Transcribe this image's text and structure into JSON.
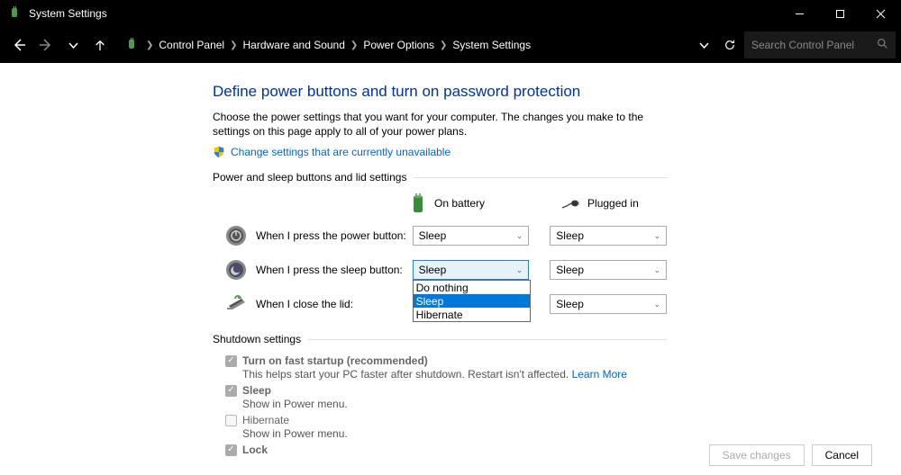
{
  "window": {
    "title": "System Settings"
  },
  "breadcrumb": {
    "items": [
      "Control Panel",
      "Hardware and Sound",
      "Power Options",
      "System Settings"
    ]
  },
  "search": {
    "placeholder": "Search Control Panel"
  },
  "page": {
    "title": "Define power buttons and turn on password protection",
    "description": "Choose the power settings that you want for your computer. The changes you make to the settings on this page apply to all of your power plans.",
    "change_link": "Change settings that are currently unavailable"
  },
  "section1": {
    "header": "Power and sleep buttons and lid settings",
    "col_battery": "On battery",
    "col_plugged": "Plugged in",
    "rows": [
      {
        "label": "When I press the power button:",
        "battery": "Sleep",
        "plugged": "Sleep"
      },
      {
        "label": "When I press the sleep button:",
        "battery": "Sleep",
        "plugged": "Sleep"
      },
      {
        "label": "When I close the lid:",
        "battery": "",
        "plugged": "Sleep"
      }
    ],
    "dropdown_options": [
      "Do nothing",
      "Sleep",
      "Hibernate"
    ]
  },
  "section2": {
    "header": "Shutdown settings",
    "items": [
      {
        "label": "Turn on fast startup (recommended)",
        "desc_pre": "This helps start your PC faster after shutdown. Restart isn't affected. ",
        "link": "Learn More",
        "checked": true
      },
      {
        "label": "Sleep",
        "desc": "Show in Power menu.",
        "checked": true
      },
      {
        "label": "Hibernate",
        "desc": "Show in Power menu.",
        "checked": false
      },
      {
        "label": "Lock",
        "desc": "",
        "checked": true
      }
    ]
  },
  "footer": {
    "save": "Save changes",
    "cancel": "Cancel"
  }
}
